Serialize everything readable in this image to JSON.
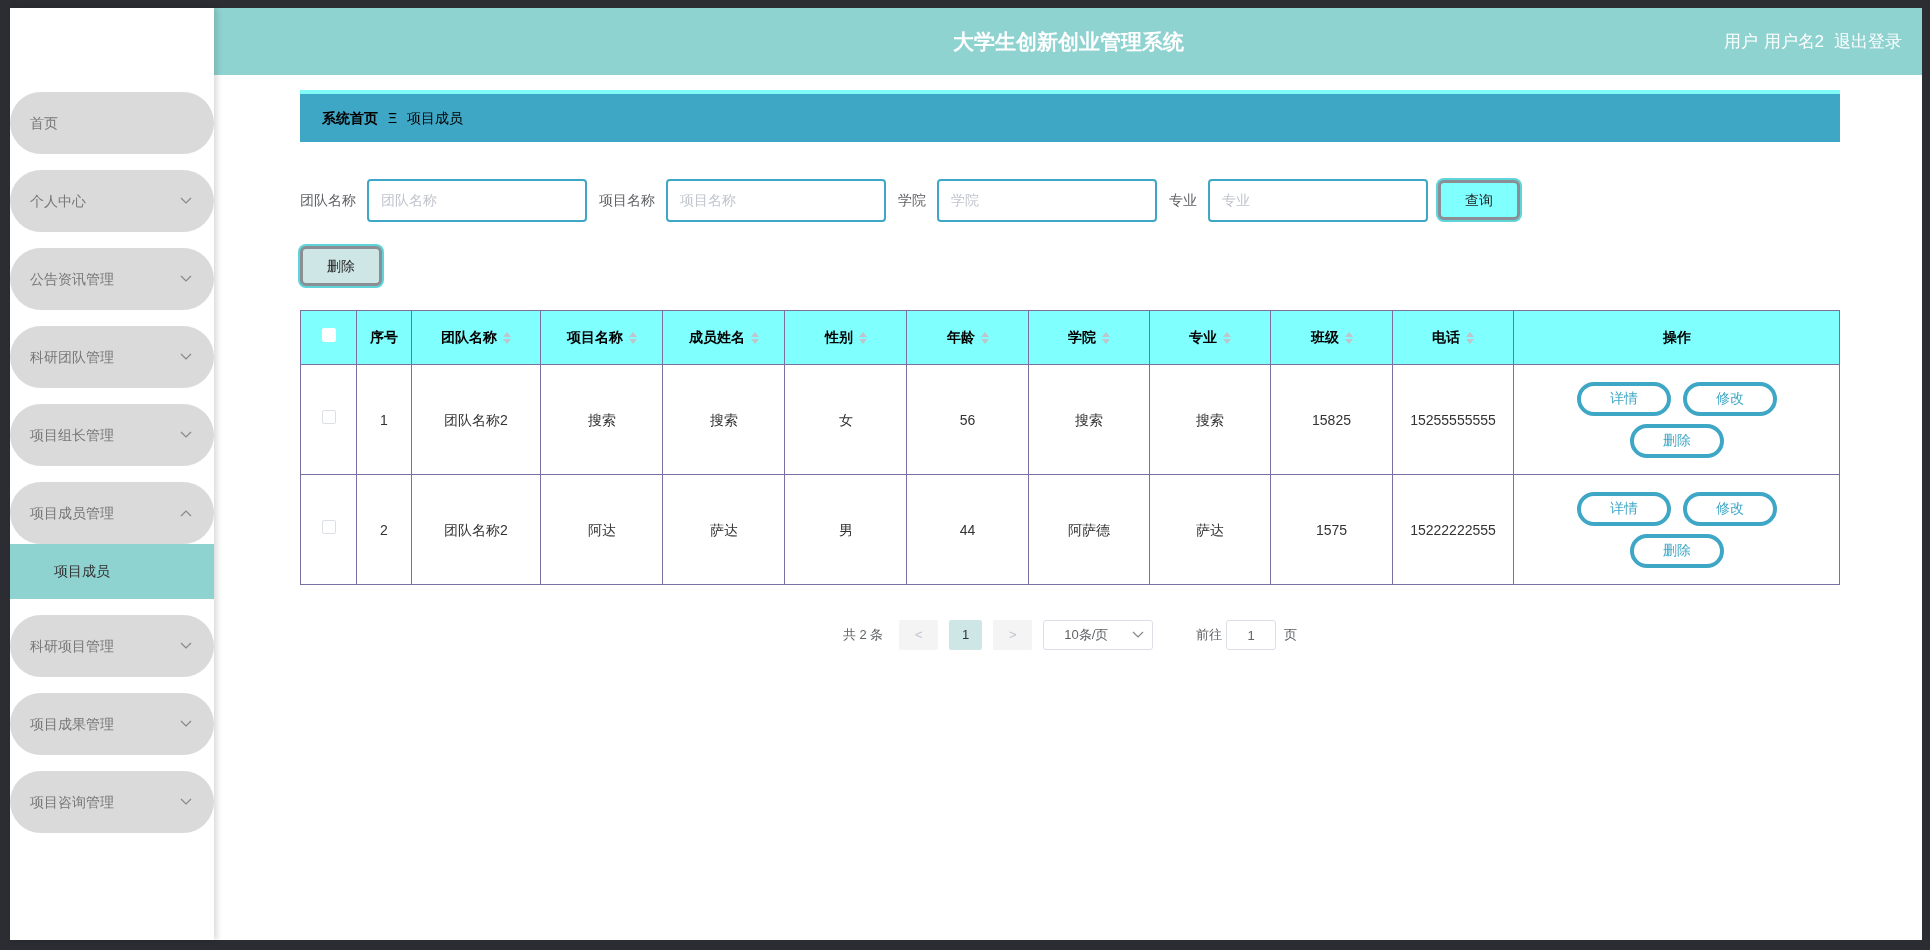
{
  "header": {
    "title": "大学生创新创业管理系统",
    "user_label": "用户",
    "username": "用户名2",
    "logout": "退出登录"
  },
  "sidebar": {
    "items": [
      {
        "label": "首页",
        "kind": "link"
      },
      {
        "label": "个人中心",
        "kind": "menu",
        "expanded": false
      },
      {
        "label": "公告资讯管理",
        "kind": "menu",
        "expanded": false
      },
      {
        "label": "科研团队管理",
        "kind": "menu",
        "expanded": false
      },
      {
        "label": "项目组长管理",
        "kind": "menu",
        "expanded": false
      },
      {
        "label": "项目成员管理",
        "kind": "menu",
        "expanded": true,
        "children": [
          {
            "label": "项目成员",
            "selected": true
          }
        ]
      },
      {
        "label": "科研项目管理",
        "kind": "menu",
        "expanded": false
      },
      {
        "label": "项目成果管理",
        "kind": "menu",
        "expanded": false
      },
      {
        "label": "项目咨询管理",
        "kind": "menu",
        "expanded": false
      }
    ]
  },
  "breadcrumb": {
    "home": "系统首页",
    "separator": "Ξ",
    "current": "项目成员"
  },
  "search": {
    "fields": [
      {
        "label": "团队名称",
        "placeholder": "团队名称"
      },
      {
        "label": "项目名称",
        "placeholder": "项目名称"
      },
      {
        "label": "学院",
        "placeholder": "学院"
      },
      {
        "label": "专业",
        "placeholder": "专业"
      }
    ],
    "button": "查询"
  },
  "delete_button": "删除",
  "table": {
    "select_all_checked": false,
    "columns": [
      {
        "label": "序号",
        "sortable": false
      },
      {
        "label": "团队名称",
        "sortable": true
      },
      {
        "label": "项目名称",
        "sortable": true
      },
      {
        "label": "成员姓名",
        "sortable": true
      },
      {
        "label": "性别",
        "sortable": true
      },
      {
        "label": "年龄",
        "sortable": true
      },
      {
        "label": "学院",
        "sortable": true
      },
      {
        "label": "专业",
        "sortable": true
      },
      {
        "label": "班级",
        "sortable": true
      },
      {
        "label": "电话",
        "sortable": true
      },
      {
        "label": "操作",
        "sortable": false
      }
    ],
    "rows": [
      {
        "checked": false,
        "cells": [
          "1",
          "团队名称2",
          "搜索",
          "搜索",
          "女",
          "56",
          "搜索",
          "搜索",
          "15825",
          "15255555555"
        ],
        "actions": [
          "详情",
          "修改",
          "删除"
        ]
      },
      {
        "checked": false,
        "cells": [
          "2",
          "团队名称2",
          "阿达",
          "萨达",
          "男",
          "44",
          "阿萨德",
          "萨达",
          "1575",
          "15222222555"
        ],
        "actions": [
          "详情",
          "修改",
          "删除"
        ]
      }
    ]
  },
  "pagination": {
    "total": "共 2 条",
    "prev": "<",
    "pages": [
      {
        "label": "1",
        "selected": true
      }
    ],
    "next": ">",
    "page_size": "10条/页",
    "goto_label": "前往",
    "goto_value": "1",
    "goto_suffix": "页"
  }
}
